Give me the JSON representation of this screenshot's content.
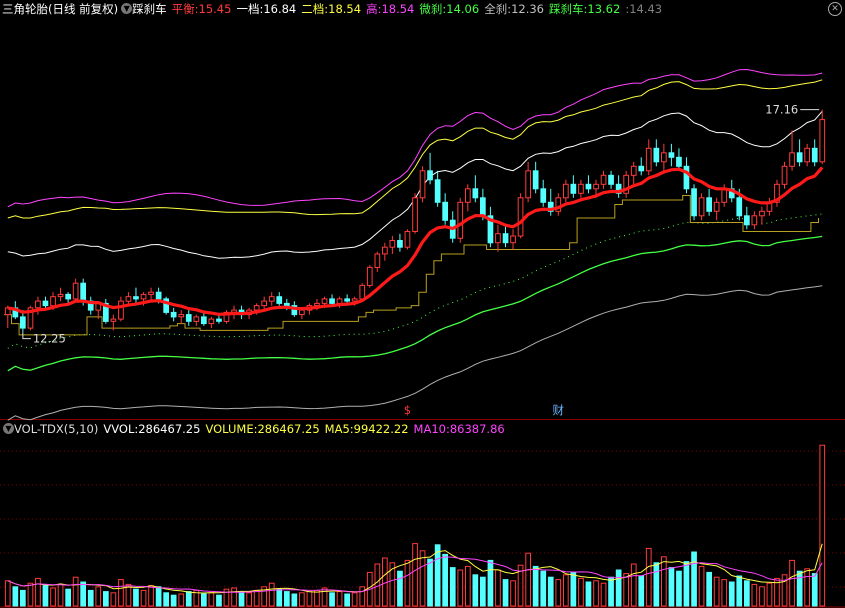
{
  "toolbar": {
    "indicator_name": "三角轮胎(日线 前复权)",
    "sub_indicator": "踩刹车",
    "items": [
      {
        "label": "平衡:",
        "value": "15.45",
        "color": "#ff3b3b"
      },
      {
        "label": "一档:",
        "value": "16.84",
        "color": "#ffffff"
      },
      {
        "label": "二档:",
        "value": "18.54",
        "color": "#ffff44"
      },
      {
        "label": "高:",
        "value": "18.54",
        "color": "#ff44ff"
      },
      {
        "label": "微刹:",
        "value": "14.06",
        "color": "#44ff44"
      },
      {
        "label": "全刹:",
        "value": "12.36",
        "color": "#c0c0c0"
      },
      {
        "label": "踩刹车:",
        "value": "13.62",
        "color": "#44ff44"
      },
      {
        "label": ":",
        "value": "14.43",
        "color": "#808080"
      }
    ],
    "close_icon": "close-icon"
  },
  "volume_bar": {
    "name": "VOL-TDX(5,10)",
    "items": [
      {
        "label": "VVOL:",
        "value": "286467.25",
        "color": "#ffffff"
      },
      {
        "label": "VOLUME:",
        "value": "286467.25",
        "color": "#ffff44"
      },
      {
        "label": "MA5:",
        "value": "99422.22",
        "color": "#ffff44"
      },
      {
        "label": "MA10:",
        "value": "86387.86",
        "color": "#ff44ff"
      }
    ]
  },
  "annotations": {
    "high_label": "17.16",
    "low_label": "12.25",
    "marker_s": "$",
    "marker_cai": "财"
  },
  "colors": {
    "up": "#ff3b3b",
    "down": "#54ffff",
    "balance": "#ff1a1a",
    "band1": "#ffffff",
    "band2": "#ffff44",
    "high": "#ff44ff",
    "micro_brake": "#44ff44",
    "full_brake": "#b0b0b0",
    "brake": "#b8a020",
    "ma5": "#ffff44",
    "ma10": "#ff44ff",
    "grid": "#7a0000"
  },
  "chart_data": {
    "type": "candlestick",
    "x": "trading days (index, labels not shown)",
    "ylim_price": [
      10.3,
      19.2
    ],
    "candles": [
      [
        12.6,
        12.8,
        12.3,
        12.75
      ],
      [
        12.75,
        12.9,
        12.5,
        12.55
      ],
      [
        12.55,
        12.7,
        12.2,
        12.3
      ],
      [
        12.3,
        12.8,
        12.25,
        12.75
      ],
      [
        12.75,
        13.0,
        12.6,
        12.9
      ],
      [
        12.9,
        13.0,
        12.7,
        12.8
      ],
      [
        12.8,
        13.1,
        12.7,
        13.0
      ],
      [
        13.0,
        13.2,
        12.9,
        13.05
      ],
      [
        13.05,
        13.1,
        12.85,
        12.95
      ],
      [
        12.95,
        13.4,
        12.9,
        13.3
      ],
      [
        13.3,
        13.4,
        12.8,
        12.9
      ],
      [
        12.9,
        13.0,
        12.6,
        12.7
      ],
      [
        12.7,
        12.9,
        12.5,
        12.85
      ],
      [
        12.85,
        12.95,
        12.4,
        12.45
      ],
      [
        12.45,
        12.6,
        12.25,
        12.5
      ],
      [
        12.5,
        13.0,
        12.45,
        12.9
      ],
      [
        12.9,
        13.1,
        12.8,
        13.0
      ],
      [
        13.0,
        13.2,
        12.85,
        12.95
      ],
      [
        12.95,
        13.1,
        12.8,
        13.05
      ],
      [
        13.05,
        13.2,
        12.9,
        13.1
      ],
      [
        13.1,
        13.2,
        12.85,
        12.95
      ],
      [
        12.95,
        13.0,
        12.6,
        12.65
      ],
      [
        12.65,
        12.75,
        12.45,
        12.55
      ],
      [
        12.55,
        12.7,
        12.4,
        12.6
      ],
      [
        12.6,
        12.7,
        12.35,
        12.45
      ],
      [
        12.45,
        12.6,
        12.35,
        12.55
      ],
      [
        12.55,
        12.65,
        12.35,
        12.4
      ],
      [
        12.4,
        12.55,
        12.3,
        12.5
      ],
      [
        12.5,
        12.6,
        12.4,
        12.45
      ],
      [
        12.45,
        12.7,
        12.4,
        12.65
      ],
      [
        12.65,
        12.8,
        12.5,
        12.7
      ],
      [
        12.7,
        12.8,
        12.5,
        12.6
      ],
      [
        12.6,
        12.75,
        12.5,
        12.7
      ],
      [
        12.7,
        12.85,
        12.6,
        12.8
      ],
      [
        12.8,
        13.0,
        12.7,
        12.9
      ],
      [
        12.9,
        13.1,
        12.8,
        13.0
      ],
      [
        13.0,
        13.1,
        12.8,
        12.85
      ],
      [
        12.85,
        12.95,
        12.7,
        12.8
      ],
      [
        12.8,
        12.9,
        12.55,
        12.6
      ],
      [
        12.6,
        12.75,
        12.5,
        12.7
      ],
      [
        12.7,
        12.85,
        12.6,
        12.8
      ],
      [
        12.8,
        12.95,
        12.7,
        12.85
      ],
      [
        12.85,
        13.0,
        12.75,
        12.95
      ],
      [
        12.95,
        13.05,
        12.8,
        12.85
      ],
      [
        12.85,
        13.0,
        12.75,
        12.95
      ],
      [
        12.95,
        13.05,
        12.8,
        12.9
      ],
      [
        12.9,
        13.0,
        12.8,
        12.95
      ],
      [
        12.95,
        13.3,
        12.9,
        13.25
      ],
      [
        13.25,
        13.7,
        13.2,
        13.65
      ],
      [
        13.65,
        14.0,
        13.55,
        13.95
      ],
      [
        13.95,
        14.2,
        13.8,
        14.1
      ],
      [
        14.1,
        14.35,
        13.95,
        14.25
      ],
      [
        14.25,
        14.4,
        14.0,
        14.1
      ],
      [
        14.1,
        14.5,
        14.05,
        14.45
      ],
      [
        14.45,
        15.3,
        14.4,
        15.2
      ],
      [
        15.2,
        15.9,
        15.1,
        15.8
      ],
      [
        15.8,
        16.2,
        15.5,
        15.6
      ],
      [
        15.6,
        15.8,
        15.0,
        15.1
      ],
      [
        15.1,
        15.3,
        14.6,
        14.7
      ],
      [
        14.7,
        14.9,
        14.2,
        14.3
      ],
      [
        14.3,
        15.2,
        14.2,
        15.1
      ],
      [
        15.1,
        15.5,
        14.9,
        15.4
      ],
      [
        15.4,
        15.7,
        15.1,
        15.2
      ],
      [
        15.2,
        15.4,
        14.7,
        14.8
      ],
      [
        14.8,
        15.0,
        14.1,
        14.2
      ],
      [
        14.2,
        14.6,
        14.0,
        14.4
      ],
      [
        14.4,
        14.6,
        14.1,
        14.2
      ],
      [
        14.2,
        14.5,
        14.05,
        14.35
      ],
      [
        14.35,
        15.3,
        14.3,
        15.2
      ],
      [
        15.2,
        16.0,
        15.1,
        15.8
      ],
      [
        15.8,
        16.0,
        15.3,
        15.4
      ],
      [
        15.4,
        15.6,
        15.0,
        15.1
      ],
      [
        15.1,
        15.4,
        14.8,
        14.9
      ],
      [
        14.9,
        15.3,
        14.8,
        15.2
      ],
      [
        15.2,
        15.6,
        15.1,
        15.5
      ],
      [
        15.5,
        15.7,
        15.2,
        15.3
      ],
      [
        15.3,
        15.6,
        15.2,
        15.5
      ],
      [
        15.5,
        15.7,
        15.3,
        15.4
      ],
      [
        15.4,
        15.6,
        15.2,
        15.5
      ],
      [
        15.5,
        15.8,
        15.4,
        15.7
      ],
      [
        15.7,
        15.8,
        15.4,
        15.5
      ],
      [
        15.5,
        15.7,
        15.2,
        15.3
      ],
      [
        15.3,
        15.8,
        15.2,
        15.7
      ],
      [
        15.7,
        16.0,
        15.5,
        15.9
      ],
      [
        15.9,
        16.1,
        15.7,
        15.8
      ],
      [
        15.8,
        16.5,
        15.7,
        16.3
      ],
      [
        16.3,
        16.5,
        15.9,
        16.0
      ],
      [
        16.0,
        16.4,
        15.8,
        16.2
      ],
      [
        16.2,
        16.4,
        15.9,
        16.1
      ],
      [
        16.1,
        16.3,
        15.8,
        15.9
      ],
      [
        15.9,
        16.1,
        15.3,
        15.4
      ],
      [
        15.4,
        15.5,
        14.7,
        14.8
      ],
      [
        14.8,
        15.3,
        14.7,
        15.2
      ],
      [
        15.2,
        15.4,
        14.8,
        14.9
      ],
      [
        14.9,
        15.2,
        14.7,
        15.1
      ],
      [
        15.1,
        15.5,
        15.0,
        15.4
      ],
      [
        15.4,
        15.6,
        15.1,
        15.2
      ],
      [
        15.2,
        15.4,
        14.7,
        14.8
      ],
      [
        14.8,
        15.0,
        14.5,
        14.6
      ],
      [
        14.6,
        14.9,
        14.5,
        14.8
      ],
      [
        14.8,
        15.0,
        14.6,
        14.9
      ],
      [
        14.9,
        15.2,
        14.8,
        15.1
      ],
      [
        15.1,
        15.6,
        15.0,
        15.5
      ],
      [
        15.5,
        16.0,
        15.4,
        15.9
      ],
      [
        15.9,
        16.7,
        15.8,
        16.2
      ],
      [
        16.2,
        16.5,
        15.9,
        16.0
      ],
      [
        16.0,
        16.4,
        15.9,
        16.3
      ],
      [
        16.3,
        16.5,
        15.9,
        16.0
      ],
      [
        16.0,
        17.16,
        15.95,
        16.94
      ]
    ],
    "volumes": [
      2.1,
      1.6,
      1.3,
      1.9,
      2.3,
      1.7,
      1.5,
      1.8,
      1.4,
      2.4,
      2.0,
      1.3,
      1.6,
      1.2,
      1.1,
      2.2,
      1.8,
      1.4,
      1.3,
      1.7,
      1.6,
      1.1,
      0.9,
      1.0,
      1.2,
      1.3,
      1.0,
      1.1,
      0.9,
      1.4,
      1.5,
      1.2,
      1.1,
      1.3,
      1.6,
      1.9,
      1.4,
      1.2,
      1.0,
      1.1,
      1.2,
      1.3,
      1.5,
      1.1,
      1.2,
      1.0,
      1.1,
      1.6,
      2.8,
      3.5,
      4.0,
      3.6,
      2.9,
      3.8,
      5.2,
      4.6,
      3.9,
      5.1,
      4.3,
      3.2,
      3.0,
      3.3,
      2.6,
      2.4,
      3.8,
      3.0,
      2.2,
      2.1,
      3.4,
      4.4,
      3.3,
      2.9,
      2.4,
      2.2,
      2.6,
      2.8,
      2.3,
      2.0,
      2.1,
      1.9,
      2.4,
      3.0,
      2.7,
      3.5,
      2.5,
      4.8,
      3.6,
      4.1,
      3.2,
      2.9,
      3.7,
      4.5,
      3.3,
      2.8,
      2.4,
      2.2,
      2.0,
      2.5,
      2.1,
      1.8,
      1.6,
      1.9,
      2.3,
      2.6,
      3.8,
      2.9,
      3.1,
      2.7,
      13.4
    ],
    "vol_ylim": [
      0,
      14.0
    ],
    "series": [
      {
        "name": "平衡"
      },
      {
        "name": "一档"
      },
      {
        "name": "二档"
      },
      {
        "name": "高"
      },
      {
        "name": "微刹"
      },
      {
        "name": "全刹"
      },
      {
        "name": "踩刹车"
      },
      {
        "name": "MA5"
      },
      {
        "name": "MA10"
      }
    ]
  }
}
